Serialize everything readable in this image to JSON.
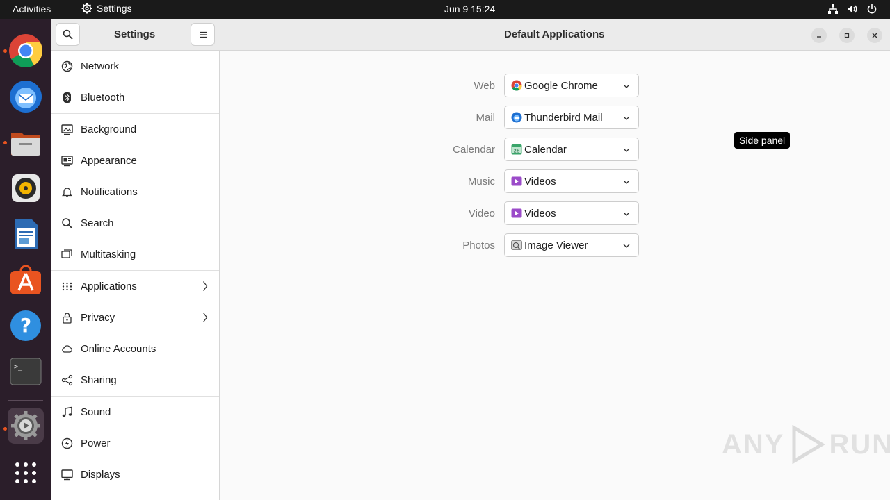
{
  "topbar": {
    "activities": "Activities",
    "app_name": "Settings",
    "clock": "Jun 9  15:24"
  },
  "dock": {
    "items": [
      {
        "icon": "chrome-icon"
      },
      {
        "icon": "thunderbird-icon"
      },
      {
        "icon": "files-icon"
      },
      {
        "icon": "rhythmbox-icon"
      },
      {
        "icon": "writer-icon"
      },
      {
        "icon": "app-center-icon"
      },
      {
        "icon": "help-icon"
      },
      {
        "icon": "terminal-icon"
      },
      {
        "icon": "settings-icon"
      },
      {
        "icon": "app-grid-icon"
      }
    ]
  },
  "sidebar": {
    "title": "Settings",
    "items": [
      {
        "label": "Network",
        "icon": "network-icon"
      },
      {
        "label": "Bluetooth",
        "icon": "bluetooth-icon"
      },
      {
        "label": "Background",
        "icon": "background-icon"
      },
      {
        "label": "Appearance",
        "icon": "appearance-icon"
      },
      {
        "label": "Notifications",
        "icon": "bell-icon"
      },
      {
        "label": "Search",
        "icon": "search-icon"
      },
      {
        "label": "Multitasking",
        "icon": "multitasking-icon"
      },
      {
        "label": "Applications",
        "icon": "apps-grid-icon"
      },
      {
        "label": "Privacy",
        "icon": "lock-icon"
      },
      {
        "label": "Online Accounts",
        "icon": "cloud-icon"
      },
      {
        "label": "Sharing",
        "icon": "share-icon"
      },
      {
        "label": "Sound",
        "icon": "music-note-icon"
      },
      {
        "label": "Power",
        "icon": "power-icon"
      },
      {
        "label": "Displays",
        "icon": "display-icon"
      }
    ]
  },
  "main": {
    "title": "Default Applications",
    "rows": [
      {
        "label": "Web",
        "value": "Google Chrome"
      },
      {
        "label": "Mail",
        "value": "Thunderbird Mail"
      },
      {
        "label": "Calendar",
        "value": "Calendar"
      },
      {
        "label": "Music",
        "value": "Videos"
      },
      {
        "label": "Video",
        "value": "Videos"
      },
      {
        "label": "Photos",
        "value": "Image Viewer"
      }
    ]
  },
  "tooltip": "Side panel",
  "watermark": "ANY RUN",
  "colors": {
    "topbar": "#1a1a1a",
    "dock": "#2b1e2a",
    "accent": "#e95420"
  }
}
